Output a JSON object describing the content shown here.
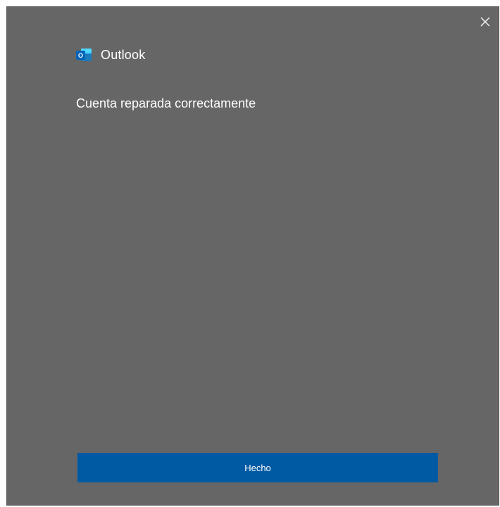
{
  "dialog": {
    "app_name": "Outlook",
    "message": "Cuenta reparada correctamente",
    "done_label": "Hecho",
    "close_icon": "close-icon",
    "logo_icon": "outlook-logo-icon",
    "logo_letter": "O"
  },
  "colors": {
    "background": "#666666",
    "button": "#005aa3",
    "text": "#ffffff",
    "logo_dark": "#0364b8",
    "logo_light": "#28a8ea"
  }
}
